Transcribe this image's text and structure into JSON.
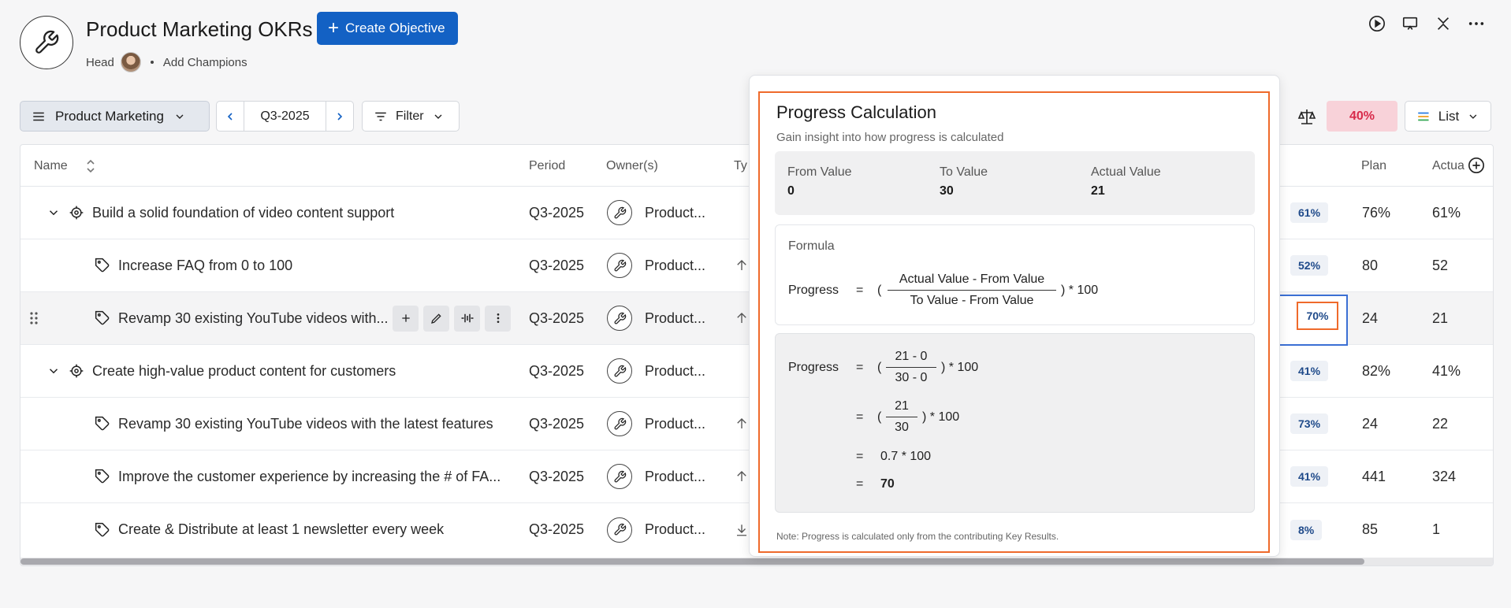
{
  "header": {
    "title": "Product Marketing OKRs",
    "create_label": "Create Objective",
    "head_label": "Head",
    "add_champions": "Add Champions"
  },
  "toolbar": {
    "team": "Product Marketing",
    "period": "Q3-2025",
    "filter_label": "Filter",
    "overall_pct": "40%",
    "view_label": "List"
  },
  "columns": {
    "name": "Name",
    "period": "Period",
    "owners": "Owner(s)",
    "type": "Ty",
    "plan": "Plan",
    "actual": "Actua"
  },
  "rows": [
    {
      "level": "objective",
      "name": "Build a solid foundation of video content support",
      "period": "Q3-2025",
      "owner": "Product...",
      "progress": "61%",
      "plan": "76%",
      "actual": "61%"
    },
    {
      "level": "kr",
      "name": "Increase FAQ from 0 to 100",
      "period": "Q3-2025",
      "owner": "Product...",
      "progress": "52%",
      "plan": "80",
      "actual": "52"
    },
    {
      "level": "kr",
      "name": "Revamp 30 existing YouTube videos with...",
      "period": "Q3-2025",
      "owner": "Product...",
      "progress": "70%",
      "plan": "24",
      "actual": "21"
    },
    {
      "level": "objective",
      "name": "Create high-value product content for customers",
      "period": "Q3-2025",
      "owner": "Product...",
      "progress": "41%",
      "plan": "82%",
      "actual": "41%"
    },
    {
      "level": "kr",
      "name": "Revamp 30 existing YouTube videos with the latest features",
      "period": "Q3-2025",
      "owner": "Product...",
      "progress": "73%",
      "plan": "24",
      "actual": "22"
    },
    {
      "level": "kr",
      "name": "Improve the customer experience by increasing the # of FA...",
      "period": "Q3-2025",
      "owner": "Product...",
      "progress": "41%",
      "plan": "441",
      "actual": "324"
    },
    {
      "level": "kr",
      "name": "Create & Distribute at least 1 newsletter every week",
      "period": "Q3-2025",
      "owner": "Product...",
      "progress": "8%",
      "plan": "85",
      "actual": "1"
    }
  ],
  "popover": {
    "title": "Progress Calculation",
    "subtitle": "Gain insight into how progress is calculated",
    "from_label": "From Value",
    "from_value": "0",
    "to_label": "To Value",
    "to_value": "30",
    "actual_label": "Actual Value",
    "actual_value": "21",
    "formula_label": "Formula",
    "progress_word": "Progress",
    "eq": "=",
    "open_paren": "(",
    "formula_num": "Actual Value - From Value",
    "formula_den": "To Value - From Value",
    "times100": ") * 100",
    "step1_num": "21 - 0",
    "step1_den": "30 - 0",
    "step2_num": "21",
    "step2_den": "30",
    "step3": "0.7 * 100",
    "result": "70",
    "note": "Note: Progress is calculated only from the contributing Key Results."
  }
}
